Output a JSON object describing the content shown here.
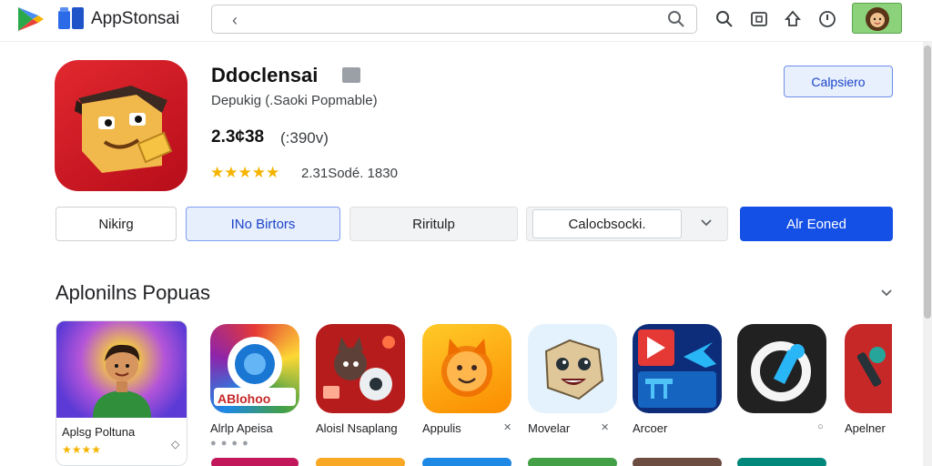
{
  "app": {
    "brand_name": "AppStonsai"
  },
  "search": {
    "back_glyph": "‹",
    "placeholder": "",
    "value": ""
  },
  "header_icons": [
    "search-icon",
    "store-icon",
    "notification-icon",
    "clock-icon"
  ],
  "listing": {
    "name": "Ddoclensai",
    "developer": "Depukig (.Saoki Popmable)",
    "price": "2.3¢38",
    "price_sub": "(:390v)",
    "stars": "★★★★★",
    "rating_text": "2.31Sodé. 1830",
    "header_button": "Calpsiero"
  },
  "actions": [
    {
      "label": "Nikirg"
    },
    {
      "label": "INo Birtors"
    },
    {
      "label": "Riritulp"
    },
    {
      "label": "Calocbsocki."
    },
    {
      "label": "Alr Eoned"
    }
  ],
  "section": {
    "title": "Aplonilns Popuas",
    "items": [
      {
        "label": "Aplsg Poltuna",
        "stars": "★★★★"
      },
      {
        "label": "Alrlp Apeisa",
        "tile_text": "ABlohoo"
      },
      {
        "label": "Aloisl Nsaplang"
      },
      {
        "label": "Appulis"
      },
      {
        "label": "Movelar"
      },
      {
        "label": "Arcoer"
      },
      {
        "label": ""
      },
      {
        "label": "Apelner"
      }
    ]
  },
  "colors": {
    "primary": "#1550e6",
    "accent_light": "#e7eefc",
    "star": "#f5b400",
    "app_icon": "#d71e28"
  }
}
